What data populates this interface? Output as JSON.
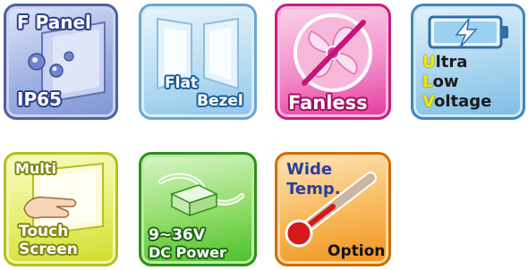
{
  "badges": {
    "f_panel": {
      "title": "F Panel",
      "subtitle": "IP65"
    },
    "flat_bezel": {
      "line1": "Flat",
      "line2": "Bezel"
    },
    "fanless": {
      "label": "Fanless"
    },
    "ulv": {
      "lines": [
        {
          "initial": "U",
          "rest": "ltra"
        },
        {
          "initial": "L",
          "rest": "ow"
        },
        {
          "initial": "V",
          "rest": "oltage"
        }
      ]
    },
    "touch": {
      "line1": "Multi",
      "line2": "Touch",
      "line3": "Screen"
    },
    "dc_power": {
      "line1": "9~36V",
      "line2": "DC Power"
    },
    "wide_temp": {
      "line1": "Wide",
      "line2": "Temp.",
      "option": "Option"
    }
  },
  "colors": {
    "f_panel": "#7e95d6",
    "flat_bezel": "#8fc6ea",
    "fanless": "#e6399d",
    "ulv": "#7fbde6",
    "touch": "#cfdc2d",
    "dc_power": "#4cbf2a",
    "wide_temp": "#f0931c",
    "ulv_initial": "#f2e600"
  },
  "icons": [
    "glass-panel-icon",
    "bezel-panels-icon",
    "crossed-fan-icon",
    "battery-bolt-icon",
    "touch-hand-icon",
    "power-adapter-icon",
    "thermometer-icon"
  ]
}
